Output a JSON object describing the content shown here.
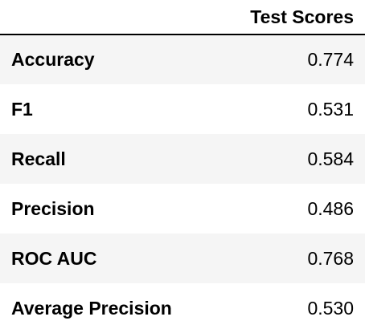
{
  "table": {
    "columns": [
      "",
      "Test Scores"
    ],
    "rows": [
      {
        "label": "Accuracy",
        "value": "0.774"
      },
      {
        "label": "F1",
        "value": "0.531"
      },
      {
        "label": "Recall",
        "value": "0.584"
      },
      {
        "label": "Precision",
        "value": "0.486"
      },
      {
        "label": "ROC AUC",
        "value": "0.768"
      },
      {
        "label": "Average Precision",
        "value": "0.530"
      }
    ]
  },
  "colors": {
    "stripe": "#f5f5f5",
    "background": "#ffffff",
    "header_rule": "#000000"
  }
}
